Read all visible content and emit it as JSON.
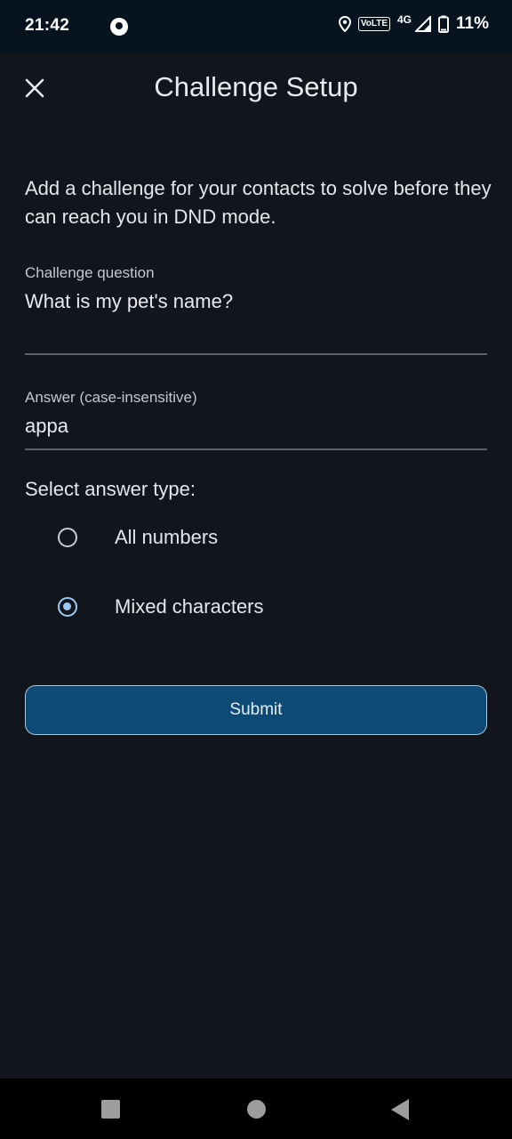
{
  "status_bar": {
    "time": "21:42",
    "volte": "VoLTE",
    "network": "4G",
    "battery": "11%"
  },
  "header": {
    "title": "Challenge Setup",
    "close_icon": "close-icon"
  },
  "description": "Add a challenge for your contacts to solve before they can reach you in DND mode.",
  "question_field": {
    "label": "Challenge question",
    "value": "What is my pet's name?"
  },
  "answer_field": {
    "label": "Answer (case-insensitive)",
    "value": "appa"
  },
  "answer_type": {
    "label": "Select answer type:",
    "options": [
      {
        "label": "All numbers",
        "selected": false
      },
      {
        "label": "Mixed characters",
        "selected": true
      }
    ]
  },
  "submit_label": "Submit",
  "colors": {
    "background": "#12151b",
    "accent": "#9ccaf5",
    "button": "#0d4a75"
  },
  "nav_icons": [
    "recents-icon",
    "home-icon",
    "back-icon"
  ]
}
